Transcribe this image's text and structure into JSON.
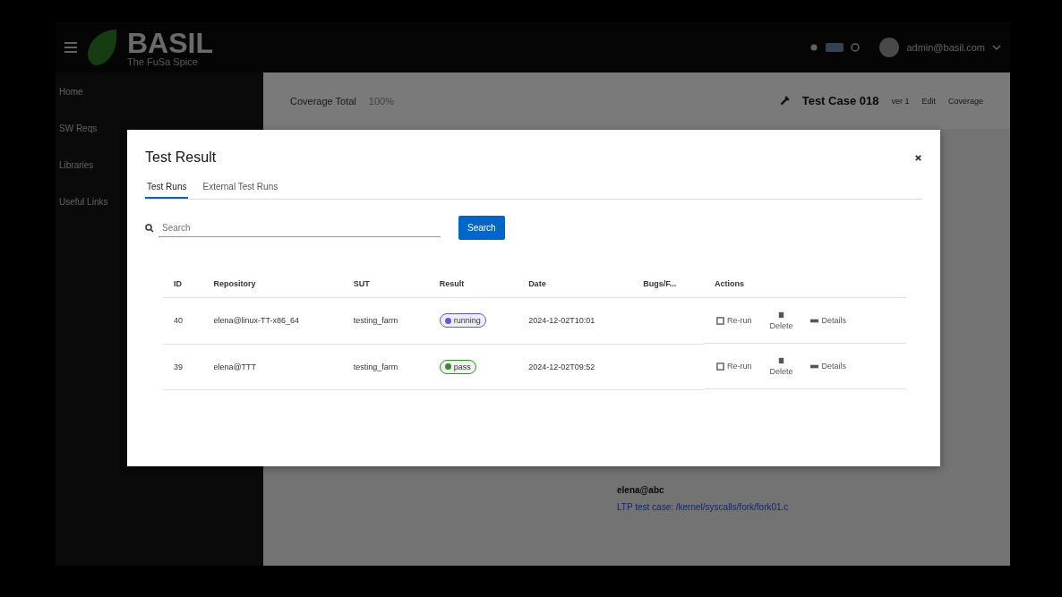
{
  "header": {
    "brand": "BASIL",
    "tagline": "The FuSa Spice",
    "user": "admin@basil.com"
  },
  "sidebar": {
    "items": [
      {
        "label": "Home",
        "selected": false
      },
      {
        "label": "SW Reqs",
        "selected": false
      },
      {
        "label": "Libraries",
        "selected": false
      },
      {
        "label": "Useful Links",
        "selected": false
      }
    ]
  },
  "background": {
    "coverage_label": "Coverage Total",
    "coverage_value": "100%",
    "test_case_title": "Test Case 018",
    "chips": [
      "ver 1",
      "Edit",
      "Coverage"
    ],
    "author": "elena@abc",
    "link_line": "LTP test case: /kernel/syscalls/fork/fork01.c"
  },
  "modal": {
    "title": "Test Result",
    "tabs": [
      {
        "label": "Test Runs",
        "selected": true
      },
      {
        "label": "External Test Runs",
        "selected": false
      }
    ],
    "search": {
      "placeholder": "Search"
    },
    "search_button": "Search",
    "table": {
      "columns": [
        "ID",
        "Repository",
        "SUT",
        "Result",
        "Date",
        "Bugs/F...",
        "Actions"
      ],
      "rows": [
        {
          "id": "40",
          "repository": "elena@linux-TT-x86_64",
          "sut": "testing_farm",
          "result": "running",
          "color": "#5b5bd6",
          "date": "2024-12-02T10:01",
          "actions": [
            "Re-run",
            "Delete",
            "Details"
          ]
        },
        {
          "id": "39",
          "repository": "elena@TTT",
          "sut": "testing_farm",
          "result": "pass",
          "color": "#3e8635",
          "date": "2024-12-02T09:52",
          "actions": [
            "Re-run",
            "Delete",
            "Details"
          ]
        }
      ]
    }
  }
}
